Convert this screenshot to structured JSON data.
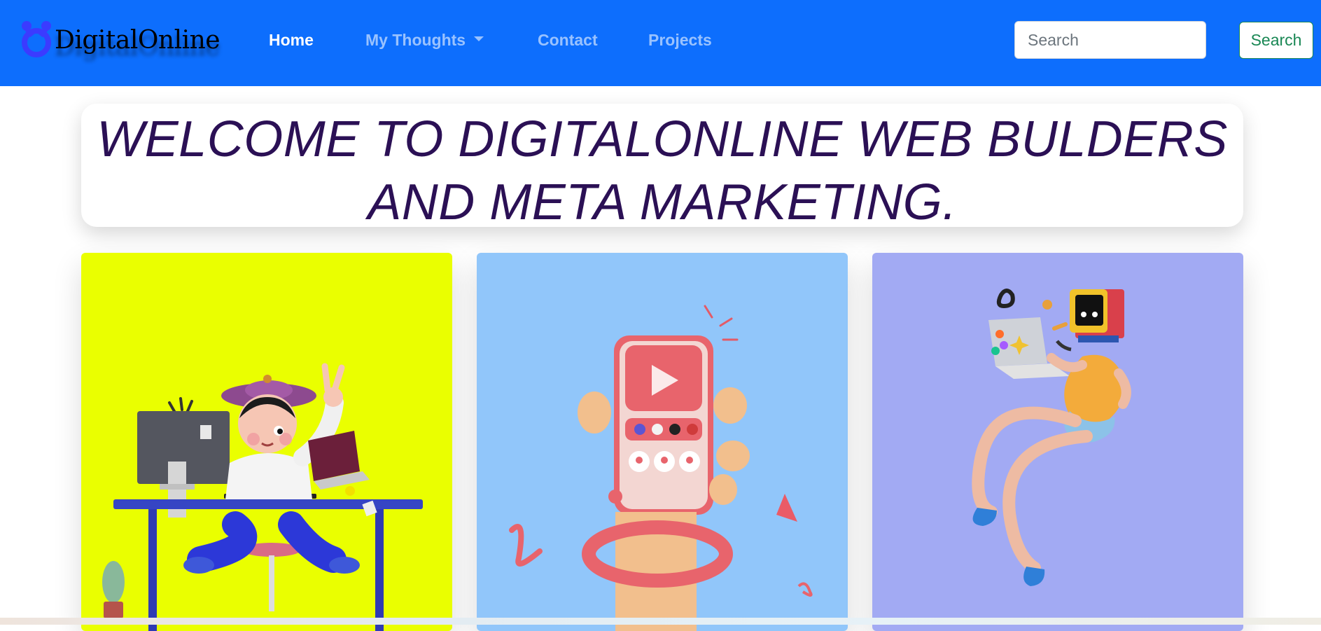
{
  "navbar": {
    "brand": "DigitalOnline",
    "links": {
      "home": "Home",
      "my_thoughts": "My Thoughts",
      "contact": "Contact",
      "projects": "Projects"
    },
    "search": {
      "placeholder": "Search",
      "button_label": "Search"
    },
    "colors": {
      "background": "#0d6efd",
      "search_button": "#198754"
    }
  },
  "hero": {
    "line1": "WELCOME TO DIGITALONLINE WEB BULDERS",
    "line2": "AND META MARKETING.",
    "color": "#2b1055"
  },
  "cards": [
    {
      "illustration": "person-at-desk-illustration",
      "background": "#eaff00"
    },
    {
      "illustration": "hand-holding-phone-video-illustration",
      "background": "#91c6fa"
    },
    {
      "illustration": "flying-person-laptop-illustration",
      "background": "#a2aaf3"
    }
  ]
}
